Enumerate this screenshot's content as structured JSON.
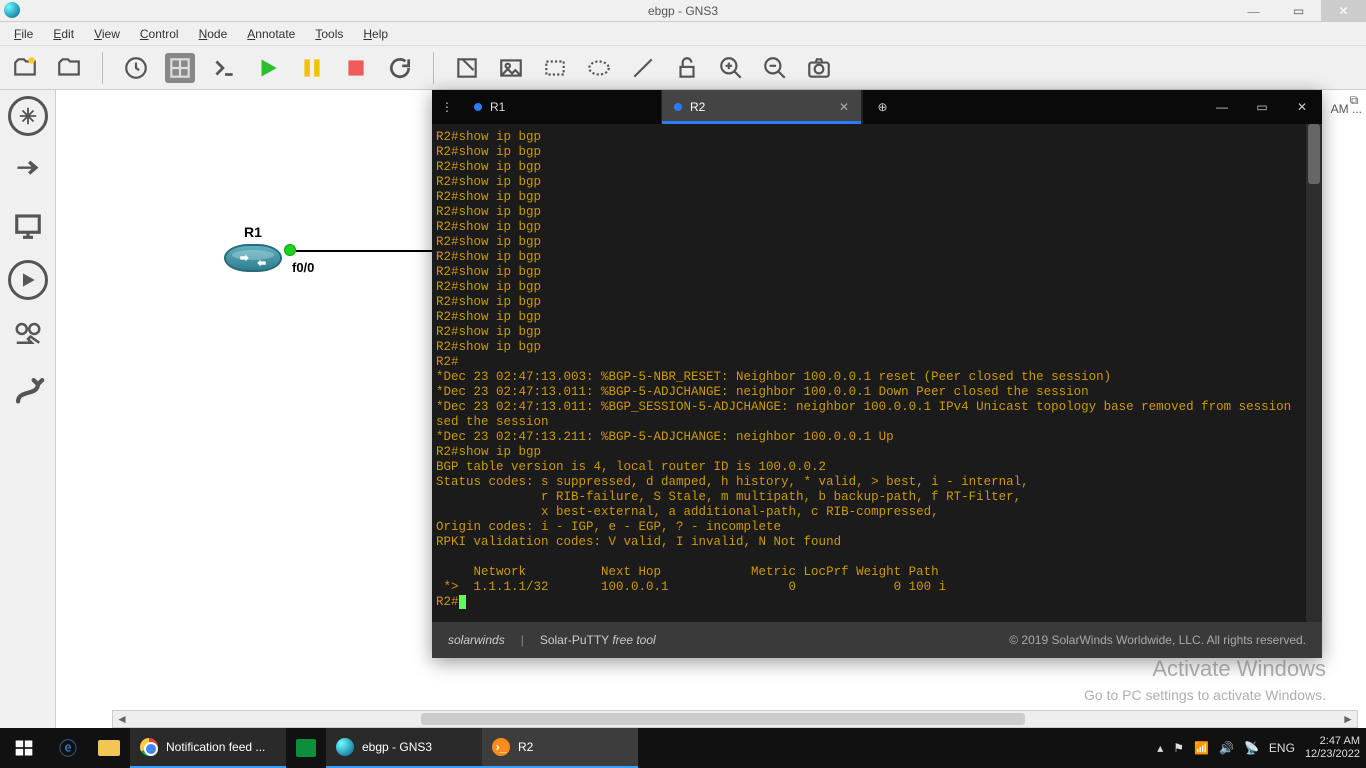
{
  "window": {
    "title": "ebgp - GNS3"
  },
  "menu": {
    "items": [
      "File",
      "Edit",
      "View",
      "Control",
      "Node",
      "Annotate",
      "Tools",
      "Help"
    ]
  },
  "canvas": {
    "router_label": "R1",
    "interface_label": "f0/0"
  },
  "terminal": {
    "tabs": [
      {
        "label": "R1",
        "active": false
      },
      {
        "label": "R2",
        "active": true
      }
    ],
    "footer_brand": "solarwinds",
    "footer_product": "Solar-PuTTY",
    "footer_tag": "free tool",
    "footer_copy": "© 2019 SolarWinds Worldwide, LLC. All rights reserved.",
    "lines": "R2#show ip bgp\nR2#show ip bgp\nR2#show ip bgp\nR2#show ip bgp\nR2#show ip bgp\nR2#show ip bgp\nR2#show ip bgp\nR2#show ip bgp\nR2#show ip bgp\nR2#show ip bgp\nR2#show ip bgp\nR2#show ip bgp\nR2#show ip bgp\nR2#show ip bgp\nR2#show ip bgp\nR2#\n*Dec 23 02:47:13.003: %BGP-5-NBR_RESET: Neighbor 100.0.0.1 reset (Peer closed the session)\n*Dec 23 02:47:13.011: %BGP-5-ADJCHANGE: neighbor 100.0.0.1 Down Peer closed the session\n*Dec 23 02:47:13.011: %BGP_SESSION-5-ADJCHANGE: neighbor 100.0.0.1 IPv4 Unicast topology base removed from session  Peer clo\nsed the session\n*Dec 23 02:47:13.211: %BGP-5-ADJCHANGE: neighbor 100.0.0.1 Up\nR2#show ip bgp\nBGP table version is 4, local router ID is 100.0.0.2\nStatus codes: s suppressed, d damped, h history, * valid, > best, i - internal,\n              r RIB-failure, S Stale, m multipath, b backup-path, f RT-Filter,\n              x best-external, a additional-path, c RIB-compressed,\nOrigin codes: i - IGP, e - EGP, ? - incomplete\nRPKI validation codes: V valid, I invalid, N Not found\n\n     Network          Next Hop            Metric LocPrf Weight Path\n *>  1.1.1.1/32       100.0.0.1                0             0 100 i",
    "prompt": "R2#"
  },
  "watermark": {
    "line1": "Activate Windows",
    "line2": "Go to PC settings to activate Windows."
  },
  "am_label": "AM ...",
  "taskbar": {
    "chrome_label": "Notification feed ...",
    "gns3_label": "ebgp - GNS3",
    "term_label": "R2",
    "lang": "ENG",
    "time": "2:47 AM",
    "date": "12/23/2022"
  }
}
